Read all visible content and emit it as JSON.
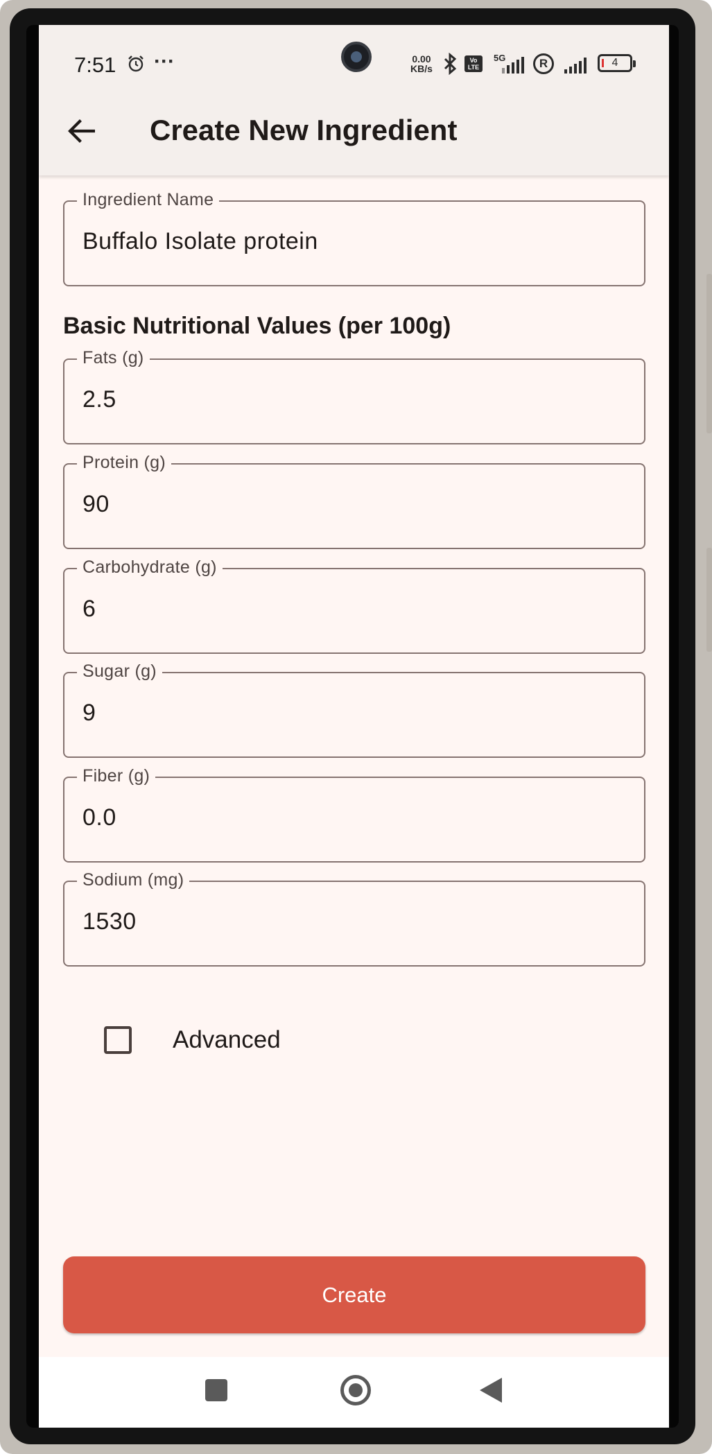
{
  "status_bar": {
    "time": "7:51",
    "dots": "···",
    "data_rate_value": "0.00",
    "data_rate_unit": "KB/s",
    "network": "5G",
    "volte": "Vo LTE",
    "roaming": "R",
    "battery": "4",
    "icons": [
      "alarm-icon",
      "bluetooth-icon",
      "volte-icon",
      "signal-icon",
      "roaming-icon",
      "battery-icon"
    ]
  },
  "app_bar": {
    "title": "Create New Ingredient",
    "back_icon": "arrow-back-icon"
  },
  "form": {
    "name_field": {
      "label": "Ingredient Name",
      "value": "Buffalo Isolate protein"
    },
    "section_heading": "Basic Nutritional Values (per 100g)",
    "fields": [
      {
        "label": "Fats (g)",
        "value": "2.5"
      },
      {
        "label": "Protein (g)",
        "value": "90"
      },
      {
        "label": "Carbohydrate (g)",
        "value": "6"
      },
      {
        "label": "Sugar (g)",
        "value": "9"
      },
      {
        "label": "Fiber (g)",
        "value": "0.0"
      },
      {
        "label": "Sodium (mg)",
        "value": "1530"
      }
    ],
    "advanced_checkbox": {
      "label": "Advanced",
      "checked": false
    },
    "create_button": "Create"
  },
  "colors": {
    "accent": "#d85846",
    "background": "#fff6f3",
    "app_bar": "#f4efec"
  }
}
